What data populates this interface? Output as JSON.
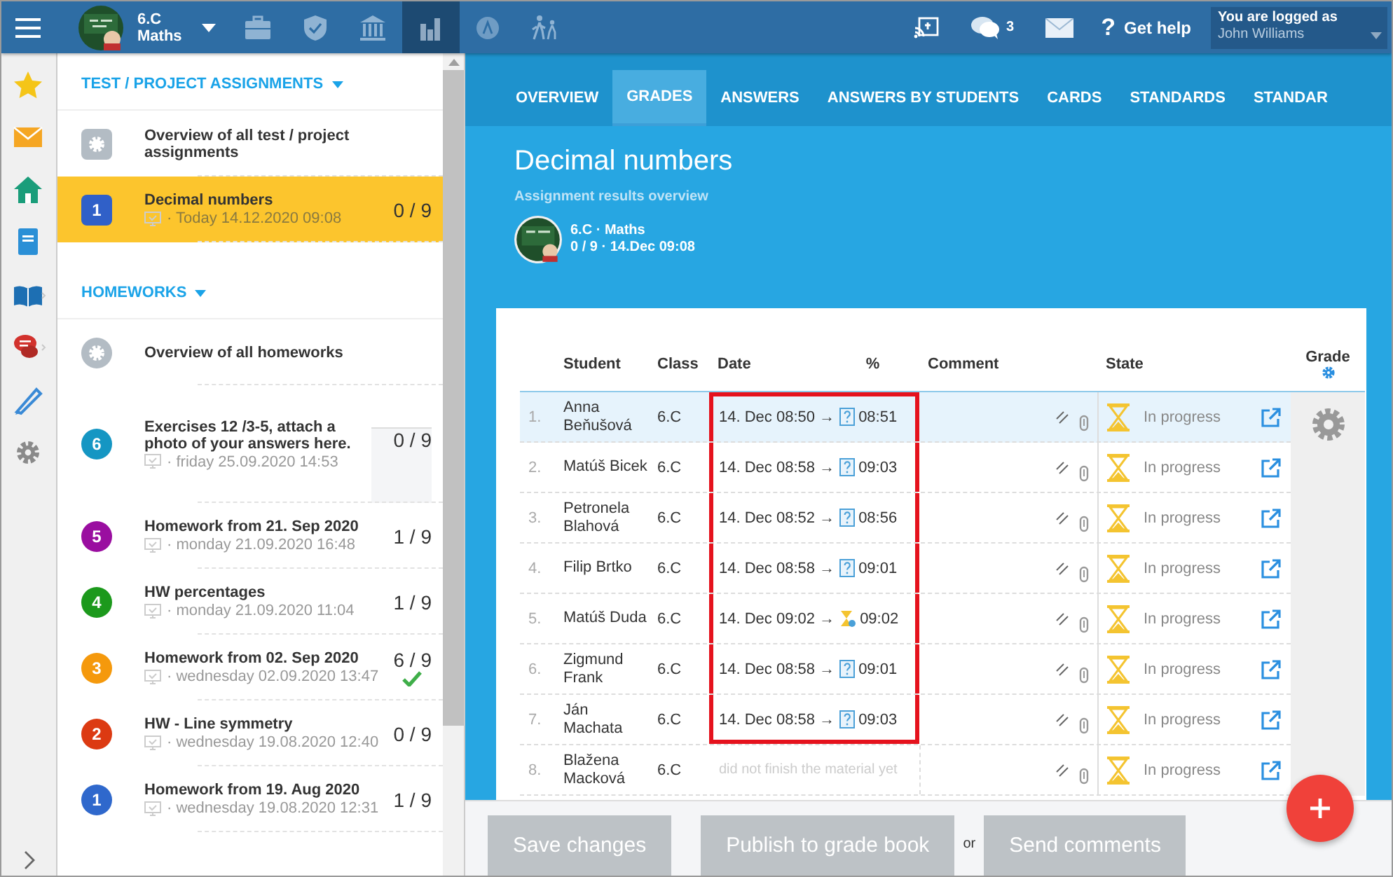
{
  "topbar": {
    "class_name": "6.C",
    "subject": "Maths",
    "nav_icons": [
      {
        "kind": "briefcase",
        "selected": false
      },
      {
        "kind": "shield",
        "selected": false
      },
      {
        "kind": "bank",
        "selected": false
      },
      {
        "kind": "chart",
        "selected": true
      },
      {
        "kind": "compass",
        "selected": false
      },
      {
        "kind": "hikers",
        "selected": false
      }
    ],
    "messages_count": "3",
    "help_mark": "?",
    "help_label": "Get help",
    "user_caption": "You are logged as",
    "user_name": "John Williams"
  },
  "rail": [
    {
      "kind": "star"
    },
    {
      "kind": "mail"
    },
    {
      "kind": "home"
    },
    {
      "kind": "notebook"
    },
    {
      "kind": "book"
    },
    {
      "kind": "chat"
    },
    {
      "kind": "pen"
    },
    {
      "kind": "gear"
    }
  ],
  "sidebar": {
    "sections": [
      {
        "title": "TEST / PROJECT ASSIGNMENTS",
        "kind": "square",
        "items": [
          {
            "kind": "overview",
            "title": "Overview of all test / project assignments",
            "selected": false
          },
          {
            "kind": "assignment",
            "badge": "1",
            "color": "#3060c8",
            "title": "Decimal numbers",
            "date": "· Today 14.12.2020 09:08",
            "score": "0 / 9",
            "done": false,
            "selected": true
          }
        ]
      },
      {
        "title": "HOMEWORKS",
        "kind": "circle",
        "items": [
          {
            "kind": "overview",
            "title": "Overview of all homeworks",
            "selected": false
          },
          {
            "kind": "assignment",
            "badge": "6",
            "color": "#1596c3",
            "title": "Exercises 12 /3-5, attach a photo of your answers here.",
            "date": "· friday 25.09.2020 14:53",
            "score": "0 / 9",
            "done": false,
            "selected": false
          },
          {
            "kind": "assignment",
            "badge": "5",
            "color": "#9a0ea0",
            "title": "Homework from 21. Sep 2020",
            "date": "· monday 21.09.2020 16:48",
            "score": "1 / 9",
            "done": false,
            "selected": false
          },
          {
            "kind": "assignment",
            "badge": "4",
            "color": "#1c991c",
            "title": "HW percentages",
            "date": "· monday 21.09.2020 11:04",
            "score": "1 / 9",
            "done": false,
            "selected": false
          },
          {
            "kind": "assignment",
            "badge": "3",
            "color": "#f5990c",
            "title": "Homework from 02. Sep 2020",
            "date": "· wednesday 02.09.2020 13:47",
            "score": "6 / 9",
            "done": true,
            "selected": false
          },
          {
            "kind": "assignment",
            "badge": "2",
            "color": "#dc3a12",
            "title": "HW - Line symmetry",
            "date": "· wednesday 19.08.2020 12:40",
            "score": "0 / 9",
            "done": false,
            "selected": false
          },
          {
            "kind": "assignment",
            "badge": "1",
            "color": "#2f68cc",
            "title": "Homework from 19. Aug 2020",
            "date": "· wednesday 19.08.2020 12:31",
            "score": "1 / 9",
            "done": false,
            "selected": false
          }
        ]
      }
    ]
  },
  "tabs": [
    {
      "label": "OVERVIEW",
      "selected": false
    },
    {
      "label": "GRADES",
      "selected": true
    },
    {
      "label": "ANSWERS",
      "selected": false
    },
    {
      "label": "ANSWERS BY STUDENTS",
      "selected": false
    },
    {
      "label": "CARDS",
      "selected": false
    },
    {
      "label": "STANDARDS",
      "selected": false
    },
    {
      "label": "STANDAR",
      "selected": false
    }
  ],
  "header": {
    "title": "Decimal numbers",
    "subtitle": "Assignment results overview",
    "class_line": "6.C · Maths",
    "meta_line": "0 / 9 · 14.Dec 09:08"
  },
  "table": {
    "columns": [
      "Student",
      "Class",
      "Date",
      "%",
      "Comment",
      "State",
      "Grade"
    ],
    "rows": [
      {
        "index": "1.",
        "name": "Anna Beňušová",
        "class": "6.C",
        "start": "14. Dec 08:50 →",
        "end_icon": {
          "kind": "question"
        },
        "end": "08:51",
        "state": "In progress",
        "selected": true,
        "highlighted": true
      },
      {
        "index": "2.",
        "name": "Matúš Bicek",
        "class": "6.C",
        "start": "14. Dec 08:58 →",
        "end_icon": {
          "kind": "question"
        },
        "end": "09:03",
        "state": "In progress",
        "selected": false,
        "highlighted": true
      },
      {
        "index": "3.",
        "name": "Petronela Blahová",
        "class": "6.C",
        "start": "14. Dec 08:52 →",
        "end_icon": {
          "kind": "question"
        },
        "end": "08:56",
        "state": "In progress",
        "selected": false,
        "highlighted": true
      },
      {
        "index": "4.",
        "name": "Filip Brtko",
        "class": "6.C",
        "start": "14. Dec 08:58 →",
        "end_icon": {
          "kind": "question"
        },
        "end": "09:01",
        "state": "In progress",
        "selected": false,
        "highlighted": true
      },
      {
        "index": "5.",
        "name": "Matúš Duda",
        "class": "6.C",
        "start": "14. Dec 09:02 →",
        "end_icon": {
          "kind": "hourglass"
        },
        "end": "09:02",
        "state": "In progress",
        "selected": false,
        "highlighted": true
      },
      {
        "index": "6.",
        "name": "Zigmund Frank",
        "class": "6.C",
        "start": "14. Dec 08:58 →",
        "end_icon": {
          "kind": "question"
        },
        "end": "09:01",
        "state": "In progress",
        "selected": false,
        "highlighted": true
      },
      {
        "index": "7.",
        "name": "Ján Machata",
        "class": "6.C",
        "start": "14. Dec 08:58 →",
        "end_icon": {
          "kind": "question"
        },
        "end": "09:03",
        "state": "In progress",
        "selected": false,
        "highlighted": true
      },
      {
        "index": "8.",
        "name": "Blažena Macková",
        "class": "6.C",
        "note": "did not finish the material yet",
        "state": "In progress",
        "selected": false,
        "highlighted": false
      }
    ]
  },
  "buttons": [
    {
      "label": "Save changes"
    },
    {
      "label": "Publish to grade book"
    },
    {
      "label": "Send comments"
    }
  ],
  "or_label": "or"
}
